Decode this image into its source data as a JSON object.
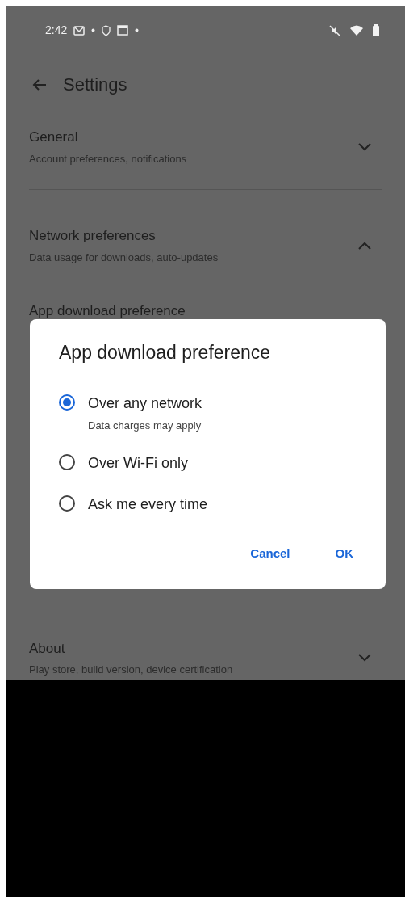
{
  "status_bar": {
    "time": "2:42"
  },
  "header": {
    "title": "Settings"
  },
  "sections": [
    {
      "title": "General",
      "subtitle": "Account preferences, notifications",
      "expanded": false
    },
    {
      "title": "Network preferences",
      "subtitle": "Data usage for downloads, auto-updates",
      "expanded": true,
      "items": [
        {
          "title": "App download preference"
        }
      ]
    },
    {
      "title": "About",
      "subtitle": "Play store, build version, device certification",
      "expanded": false
    }
  ],
  "dialog": {
    "title": "App download preference",
    "options": [
      {
        "label": "Over any network",
        "subtitle": "Data charges may apply",
        "selected": true
      },
      {
        "label": "Over Wi-Fi only",
        "selected": false
      },
      {
        "label": "Ask me every time",
        "selected": false
      }
    ],
    "buttons": [
      "Cancel",
      "OK"
    ]
  }
}
